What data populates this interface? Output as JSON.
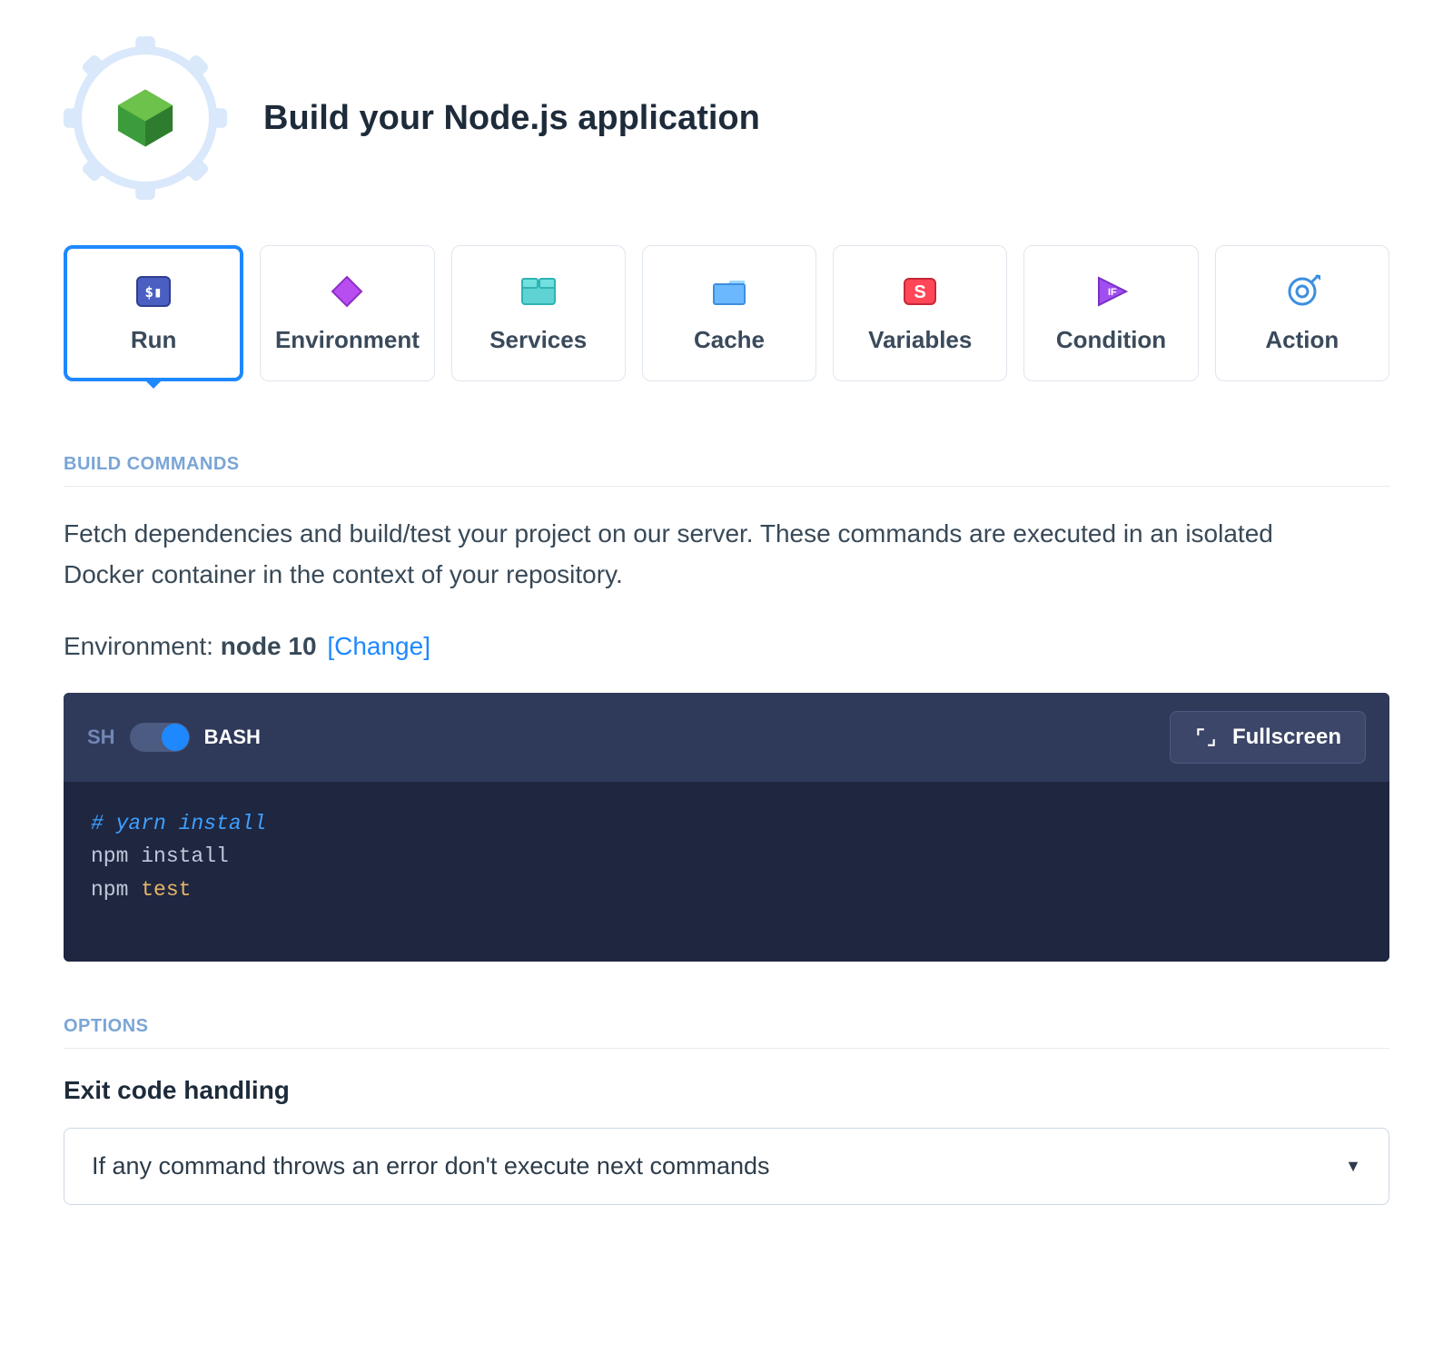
{
  "header": {
    "title": "Build your Node.js application"
  },
  "tabs": [
    {
      "id": "run",
      "label": "Run",
      "active": true
    },
    {
      "id": "environment",
      "label": "Environment",
      "active": false
    },
    {
      "id": "services",
      "label": "Services",
      "active": false
    },
    {
      "id": "cache",
      "label": "Cache",
      "active": false
    },
    {
      "id": "variables",
      "label": "Variables",
      "active": false
    },
    {
      "id": "condition",
      "label": "Condition",
      "active": false
    },
    {
      "id": "action",
      "label": "Action",
      "active": false
    }
  ],
  "buildCommands": {
    "sectionLabel": "BUILD COMMANDS",
    "description": "Fetch dependencies and build/test your project on our server. These commands are executed in an isolated Docker container in the context of your repository.",
    "environmentLabel": "Environment: ",
    "environmentValue": "node 10",
    "changeLinkText": "[Change]",
    "shellOff": "SH",
    "shellOn": "BASH",
    "shellActive": "BASH",
    "fullscreenLabel": "Fullscreen",
    "code": {
      "lines": [
        {
          "tokens": [
            {
              "t": "comment",
              "v": "# yarn install"
            }
          ]
        },
        {
          "tokens": [
            {
              "t": "plain",
              "v": "npm install"
            }
          ]
        },
        {
          "tokens": [
            {
              "t": "plain",
              "v": "npm "
            },
            {
              "t": "kw",
              "v": "test"
            }
          ]
        }
      ]
    }
  },
  "options": {
    "sectionLabel": "OPTIONS",
    "exitCodeTitle": "Exit code handling",
    "exitCodeValue": "If any command throws an error don't execute next commands"
  }
}
